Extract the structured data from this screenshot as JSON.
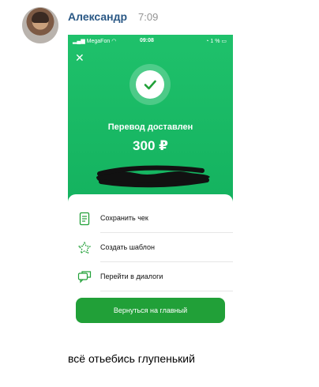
{
  "message": {
    "author": "Александр",
    "time": "7:09",
    "text": "всё отьебись глупенький"
  },
  "screenshot": {
    "status_bar": {
      "carrier": "MegaFon",
      "clock": "09:08",
      "battery": "1 %"
    },
    "close_glyph": "✕",
    "title": "Перевод доставлен",
    "amount": "300 ₽",
    "actions": [
      {
        "label": "Сохранить чек",
        "icon": "receipt-icon"
      },
      {
        "label": "Создать шаблон",
        "icon": "star-icon"
      },
      {
        "label": "Перейти в диалоги",
        "icon": "chat-icon"
      }
    ],
    "primary_button": "Вернуться на главный"
  },
  "colors": {
    "author": "#2a5885",
    "brand_green": "#21a038",
    "header_green": "#1fc16b"
  }
}
